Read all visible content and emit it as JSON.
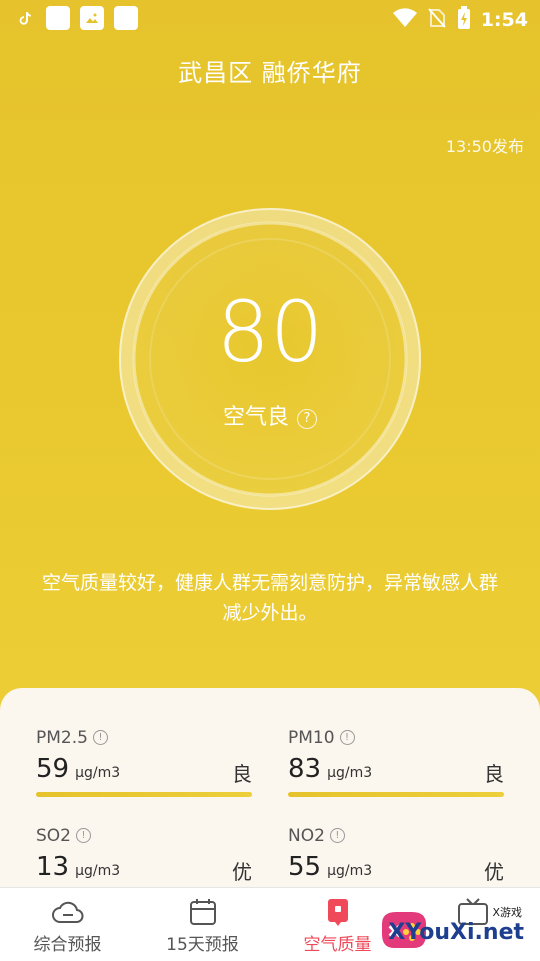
{
  "status_bar": {
    "time": "1:54",
    "icons": [
      "tiktok-icon",
      "square-icon",
      "image-icon",
      "square-icon",
      "wifi-icon",
      "no-sim-icon",
      "battery-charging-icon"
    ]
  },
  "header": {
    "location": "武昌区 融侨华府",
    "published": "13:50发布"
  },
  "aqi": {
    "value": "80",
    "level": "空气良",
    "help": "?"
  },
  "advice": "空气质量较好，健康人群无需刻意防护，异常敏感人群减少外出。",
  "pollutants": [
    {
      "name": "PM2.5",
      "value": "59",
      "unit": "μg/m3",
      "level": "良"
    },
    {
      "name": "PM10",
      "value": "83",
      "unit": "μg/m3",
      "level": "良"
    },
    {
      "name": "SO2",
      "value": "13",
      "unit": "μg/m3",
      "level": "优"
    },
    {
      "name": "NO2",
      "value": "55",
      "unit": "μg/m3",
      "level": "优"
    }
  ],
  "tabs": [
    {
      "label": "综合预报",
      "icon": "cloud-icon",
      "active": false
    },
    {
      "label": "15天预报",
      "icon": "calendar-icon",
      "active": false
    },
    {
      "label": "空气质量",
      "icon": "air-quality-icon",
      "active": true
    },
    {
      "label": "",
      "icon": "tv-icon",
      "active": false
    }
  ],
  "watermark": {
    "text": "XYouXi.net",
    "small": "X游戏"
  },
  "colors": {
    "accent": "#f04a5a",
    "background": "#e9c92f",
    "card": "#fbf6ee"
  }
}
